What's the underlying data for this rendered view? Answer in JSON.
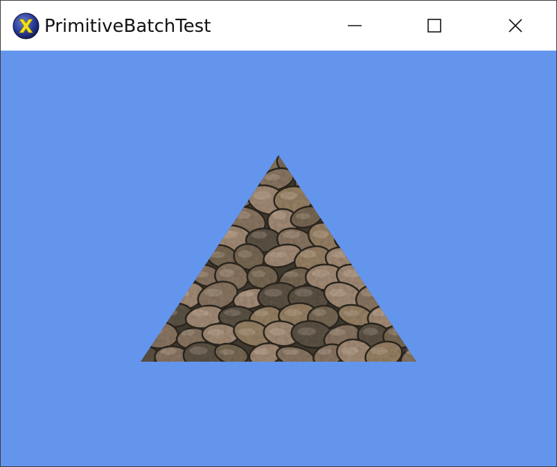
{
  "window": {
    "title": "PrimitiveBatchTest",
    "app_icon": "xna-x-logo-icon",
    "controls": {
      "minimize_icon": "minimize-icon",
      "maximize_icon": "maximize-icon",
      "close_icon": "close-icon"
    }
  },
  "scene": {
    "clear_color": "#6495ED",
    "primitive": "triangle",
    "texture": "cobblestone",
    "texture_colors": [
      "#7a6a55",
      "#9a8366",
      "#5e5446",
      "#a68e78",
      "#8c7763",
      "#3f382e"
    ]
  }
}
